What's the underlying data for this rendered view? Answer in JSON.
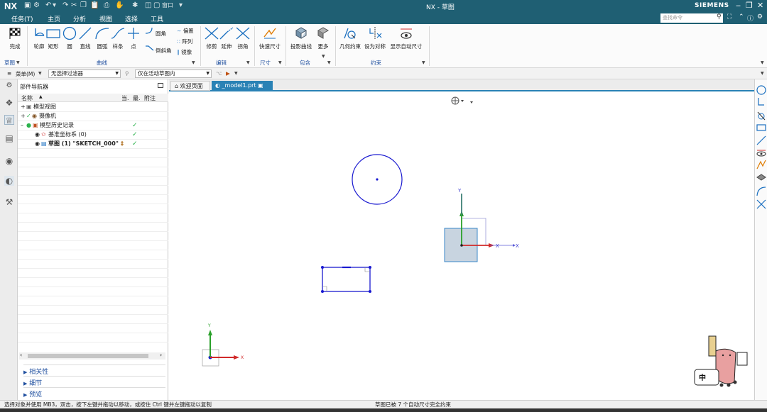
{
  "app": {
    "logo": "NX",
    "window_title": "NX - 草图",
    "brand": "SIEMENS",
    "window_menu": "窗口"
  },
  "tabs": [
    {
      "label": "任务(T)"
    },
    {
      "label": "主页",
      "active": true
    },
    {
      "label": "分析"
    },
    {
      "label": "视图"
    },
    {
      "label": "选择"
    },
    {
      "label": "工具"
    }
  ],
  "search": {
    "placeholder": "查找命令"
  },
  "ribbon": {
    "finish": "完成",
    "outline": "轮廓",
    "rectangle": "矩形",
    "circle": "圆",
    "line": "直线",
    "arc": "圆弧",
    "spline": "样条",
    "point": "点",
    "fillet": "圆角",
    "chamfer": "倒斜角",
    "offset": "偏置",
    "pattern": "阵列",
    "mirror": "镜像",
    "trim": "修剪",
    "extend": "延伸",
    "corner": "拐角",
    "rapid_dim": "快速尺寸",
    "project_curve": "投影曲线",
    "more": "更多",
    "geo_constraint": "几何约束",
    "make_symmetric": "设为对称",
    "show_auto_dim": "显示自动尺寸",
    "groups": {
      "sketch": "草图",
      "curve": "曲线",
      "edit": "编辑",
      "dimension": "尺寸",
      "include": "包含",
      "constraint": "约束"
    }
  },
  "filterbar": {
    "menu": "菜单(M)",
    "type_filter": "无选择过滤器",
    "scope": "仅在活动草图内"
  },
  "navigator": {
    "title": "部件导航器",
    "col_name": "名称",
    "col_current": "当.",
    "col_latest": "最.",
    "col_note": "附注",
    "rows": [
      {
        "label": "模型视图"
      },
      {
        "label": "摄像机"
      },
      {
        "label": "模型历史记录"
      },
      {
        "label": "基准坐标系 (0)"
      },
      {
        "label": "草图 (1) \"SKETCH_000\""
      }
    ],
    "sections": [
      "相关性",
      "细节",
      "预览"
    ]
  },
  "doc_tabs": [
    {
      "label": "欢迎页面"
    },
    {
      "label": "_model1.prt"
    }
  ],
  "axes": {
    "x": "X",
    "y": "Y"
  },
  "status": {
    "left": "选择对象并使用 MB3，双击，按下左键并拖动以移动，或按住 Ctrl 键并左键拖动以复制",
    "right": "草图已被 7 个自动尺寸完全约束"
  },
  "colors": {
    "title_bg": "#1f5f73",
    "accent": "#2a82b5",
    "sketch_blue": "#1a1ad0",
    "axis_red": "#d12a2a",
    "axis_green": "#2aa02a"
  }
}
